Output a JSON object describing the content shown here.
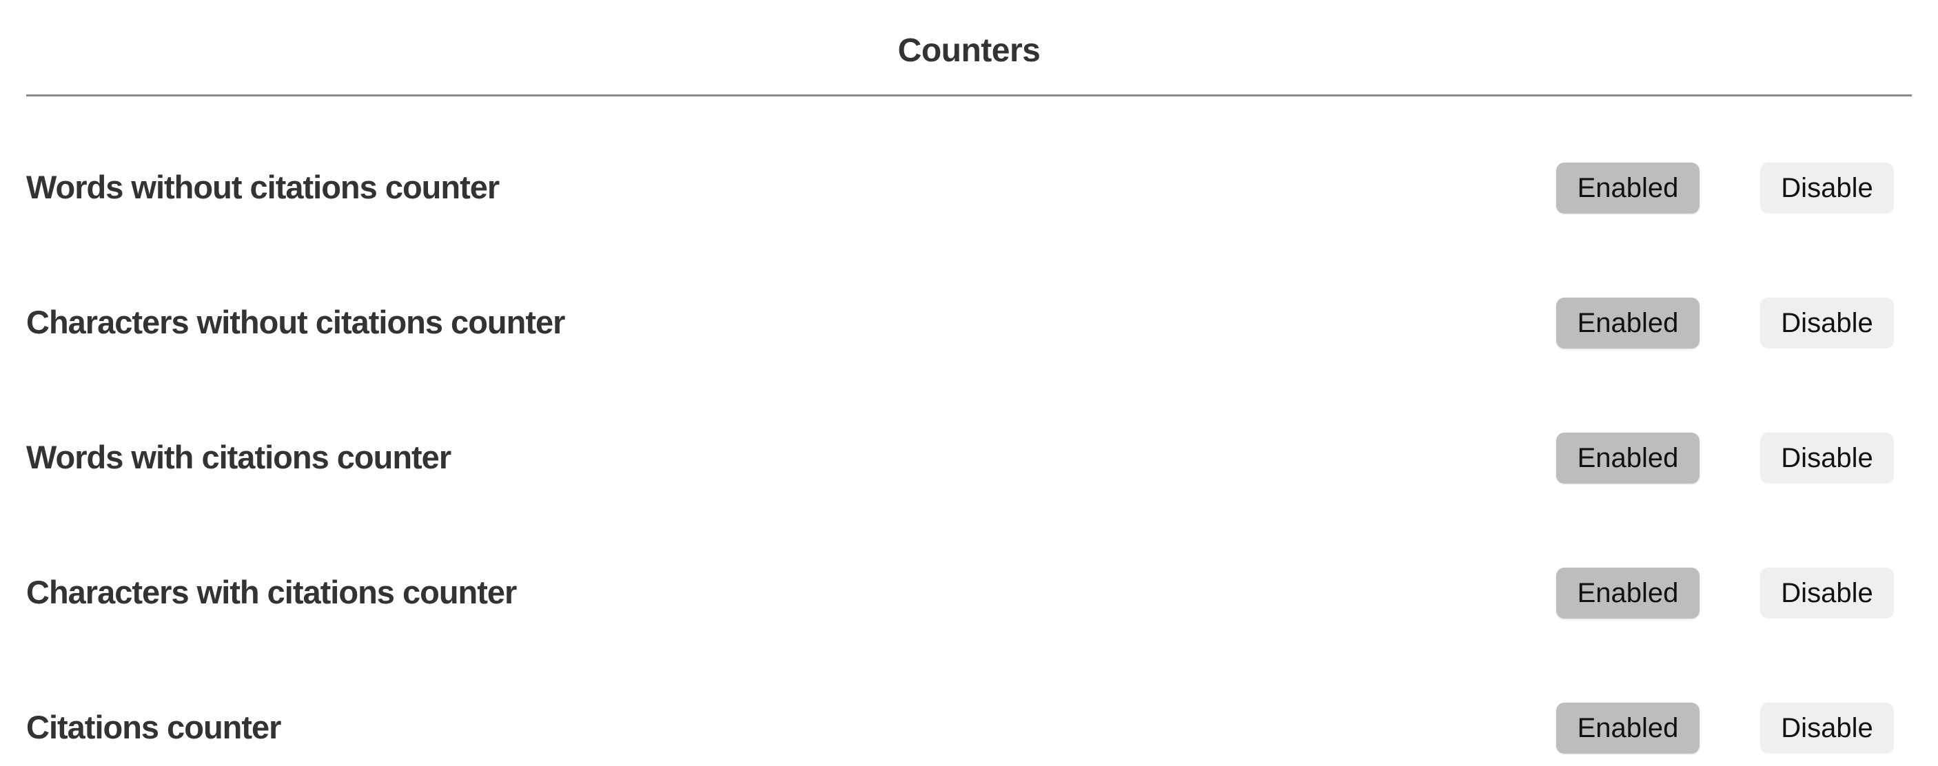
{
  "page": {
    "title": "Counters"
  },
  "counters": [
    {
      "label": "Words without citations counter",
      "enabled_label": "Enabled",
      "disable_label": "Disable"
    },
    {
      "label": "Characters without citations counter",
      "enabled_label": "Enabled",
      "disable_label": "Disable"
    },
    {
      "label": "Words with citations counter",
      "enabled_label": "Enabled",
      "disable_label": "Disable"
    },
    {
      "label": "Characters with citations counter",
      "enabled_label": "Enabled",
      "disable_label": "Disable"
    },
    {
      "label": "Citations counter",
      "enabled_label": "Enabled",
      "disable_label": "Disable"
    }
  ],
  "colors": {
    "enabled_button_bg": "#bdbdbd",
    "disable_button_bg": "#efefef",
    "text": "#333333",
    "divider": "#8a8a8a"
  }
}
